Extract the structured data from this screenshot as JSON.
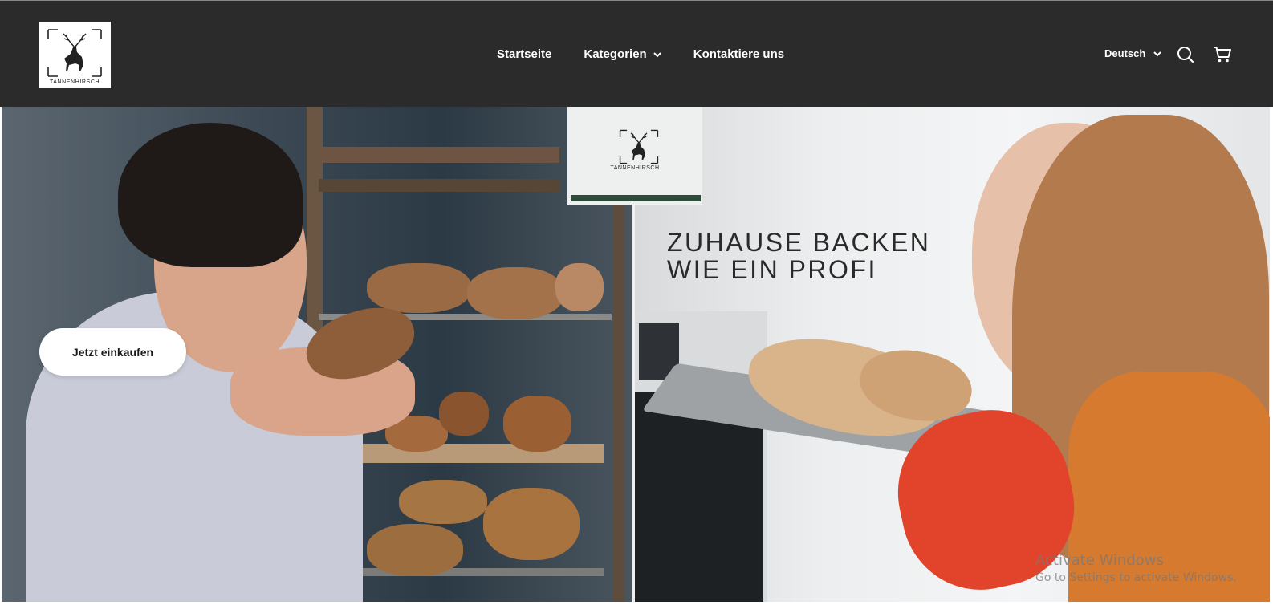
{
  "header": {
    "logo_text": "TANNENHIRSCH",
    "nav": [
      {
        "label": "Startseite"
      },
      {
        "label": "Kategorien"
      },
      {
        "label": "Kontaktiere uns"
      }
    ],
    "language": "Deutsch",
    "icons": {
      "search": "search-icon",
      "cart": "cart-icon",
      "chevron": "chevron-down-icon"
    },
    "colors": {
      "background": "#2b2b2b",
      "text": "#ffffff"
    }
  },
  "hero": {
    "logo_text": "TANNENHIRSCH",
    "headline_line1": "ZUHAUSE BACKEN",
    "headline_line2": "WIE EIN PROFI",
    "cta_label": "Jetzt einkaufen",
    "accent_color": "#2e4a3a"
  },
  "watermark": {
    "line1": "Activate Windows",
    "line2": "Go to Settings to activate Windows."
  }
}
